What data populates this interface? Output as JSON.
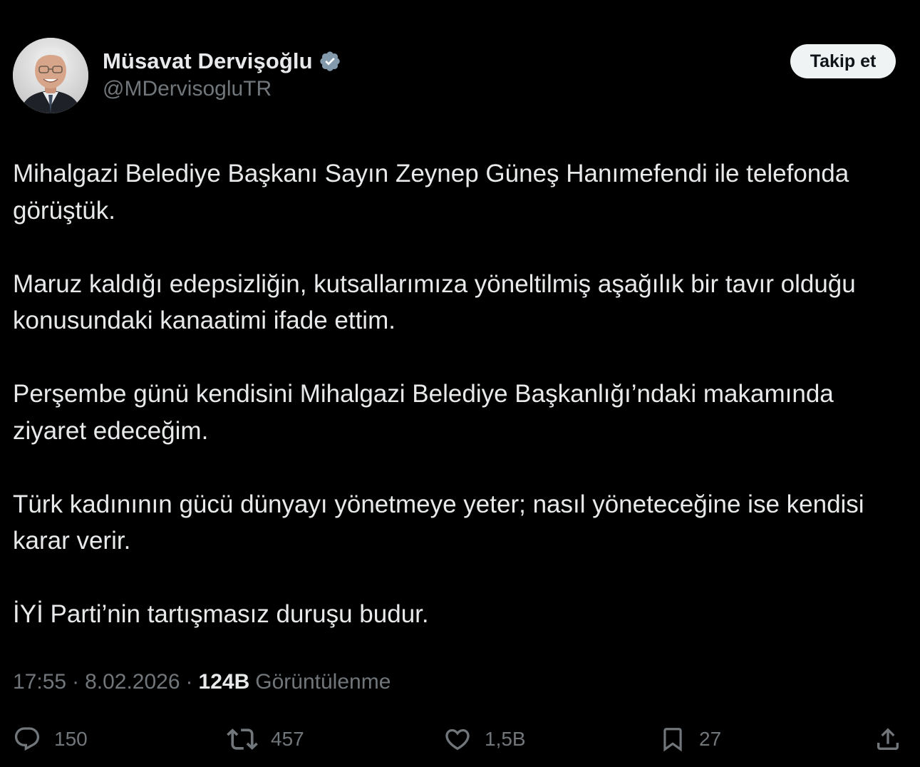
{
  "author": {
    "display_name": "Müsavat Dervişoğlu",
    "handle": "@MDervisogluTR",
    "verified": true,
    "verified_color": "#829aab"
  },
  "follow_button": {
    "label": "Takip et"
  },
  "tweet": {
    "paragraphs": [
      "Mihalgazi Belediye Başkanı Sayın Zeynep Güneş Hanımefendi ile telefonda görüştük.",
      "Maruz kaldığı edepsizliğin, kutsallarımıza yöneltilmiş aşağılık bir tavır olduğu konusundaki kanaatimi ifade ettim.",
      "Perşembe günü kendisini Mihalgazi Belediye Başkanlığı’ndaki makamında ziyaret edeceğim.",
      "Türk kadınının gücü dünyayı yönetmeye yeter; nasıl yöneteceğine ise kendisi karar verir.",
      "İYİ Parti’nin tartışmasız duruşu budur."
    ],
    "time": "17:55",
    "separator": "·",
    "date": "8.02.2026",
    "views_count": "124B",
    "views_label": "Görüntülenme"
  },
  "actions": {
    "reply": {
      "icon": "reply-icon",
      "count": "150"
    },
    "retweet": {
      "icon": "retweet-icon",
      "count": "457"
    },
    "like": {
      "icon": "heart-icon",
      "count": "1,5B"
    },
    "bookmark": {
      "icon": "bookmark-icon",
      "count": "27"
    },
    "share": {
      "icon": "share-icon"
    }
  },
  "colors": {
    "background": "#000000",
    "text_primary": "#e7e9ea",
    "text_secondary": "#71767b",
    "button_bg": "#eff3f4",
    "button_text": "#0f1419"
  }
}
